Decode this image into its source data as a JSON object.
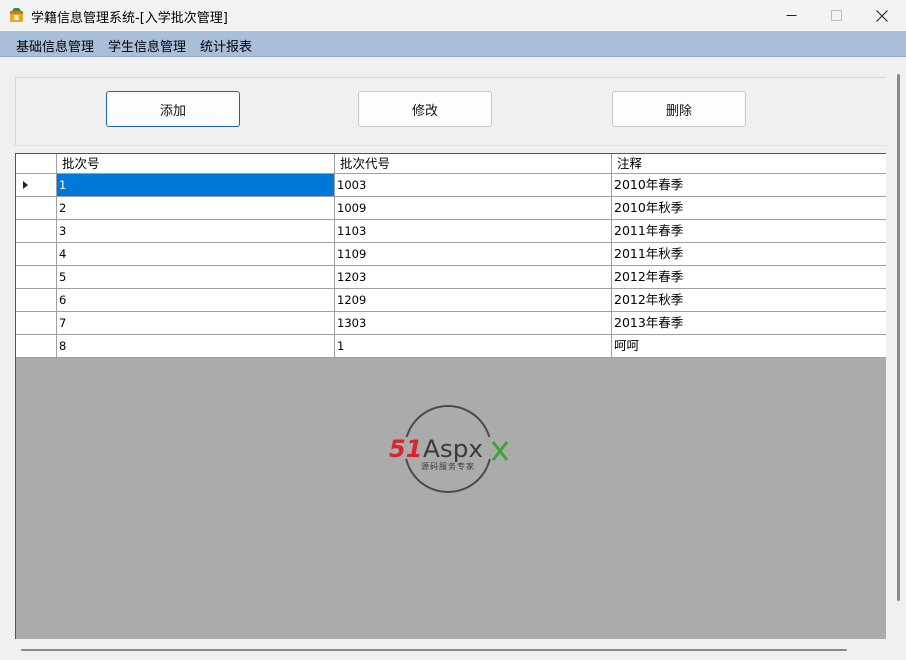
{
  "window": {
    "title": "学籍信息管理系统-[入学批次管理]",
    "controls": {
      "minimize": "—",
      "maximize": "☐",
      "close": "✕"
    }
  },
  "menu": {
    "items": [
      "基础信息管理",
      "学生信息管理",
      "统计报表"
    ]
  },
  "toolbar": {
    "add_label": "添加",
    "edit_label": "修改",
    "delete_label": "删除"
  },
  "grid": {
    "columns": [
      "批次号",
      "批次代号",
      "注释"
    ],
    "rows": [
      [
        "1",
        "1003",
        "2010年春季"
      ],
      [
        "2",
        "1009",
        "2010年秋季"
      ],
      [
        "3",
        "1103",
        "2011年春季"
      ],
      [
        "4",
        "1109",
        "2011年秋季"
      ],
      [
        "5",
        "1203",
        "2012年春季"
      ],
      [
        "6",
        "1209",
        "2012年秋季"
      ],
      [
        "7",
        "1303",
        "2013年春季"
      ],
      [
        "8",
        "1",
        "呵呵"
      ]
    ],
    "selected_row": 0
  },
  "watermark": {
    "brand_51": "51",
    "brand_aspx": "Aspx",
    "tagline": "源码服务专家"
  },
  "colors": {
    "accent": "#0078d7",
    "menubar": "#a9bed9",
    "grid_background": "#ababab",
    "watermark_red": "#d6262b",
    "watermark_green": "#3aa63a"
  }
}
